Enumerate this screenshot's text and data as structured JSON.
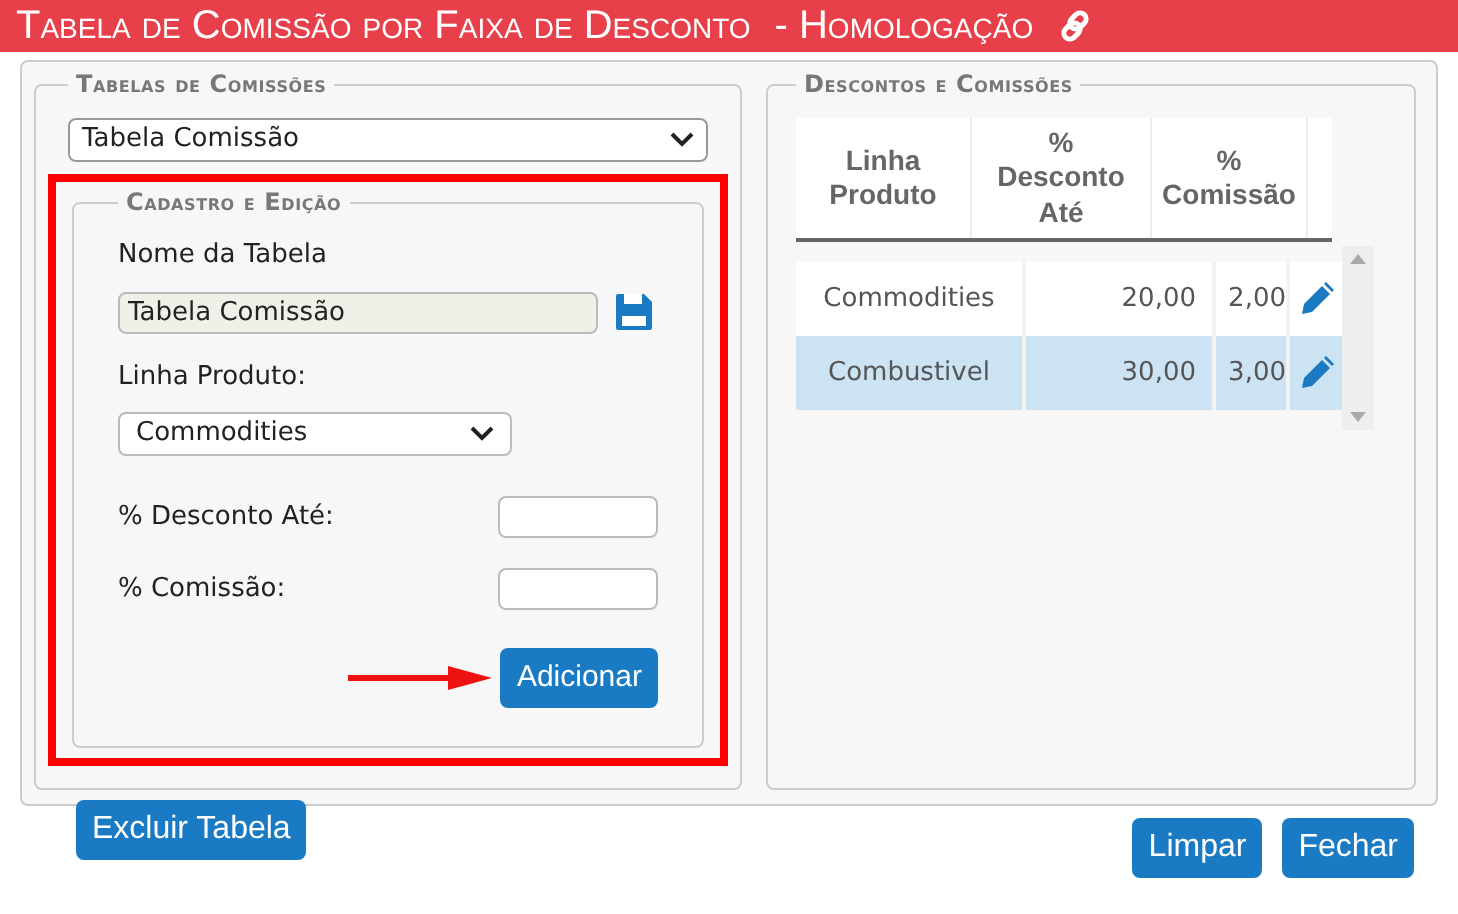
{
  "window": {
    "title": "Tabela de Comissão por Faixa de Desconto",
    "environment": "- Homologação"
  },
  "tables_panel": {
    "legend": "Tabelas de Comissões",
    "table_select": "Tabela Comissão"
  },
  "edit_panel": {
    "legend": "Cadastro e Edição",
    "name_label": "Nome da Tabela",
    "name_value": "Tabela Comissão",
    "line_label": "Linha Produto:",
    "line_select": "Commodities",
    "discount_label": "% Desconto Até:",
    "commission_label": "% Comissão:",
    "add_button": "Adicionar"
  },
  "discounts_panel": {
    "legend": "Descontos e Comissões",
    "columns": [
      "Linha Produto",
      "% Desconto Até",
      "% Comissão"
    ],
    "rows": [
      {
        "line": "Commodities",
        "discount": "20,00",
        "commission": "2,00",
        "selected": false
      },
      {
        "line": "Combustivel",
        "discount": "30,00",
        "commission": "3,00",
        "selected": true
      }
    ]
  },
  "buttons": {
    "delete": "Excluir Tabela",
    "clear": "Limpar",
    "close": "Fechar"
  }
}
